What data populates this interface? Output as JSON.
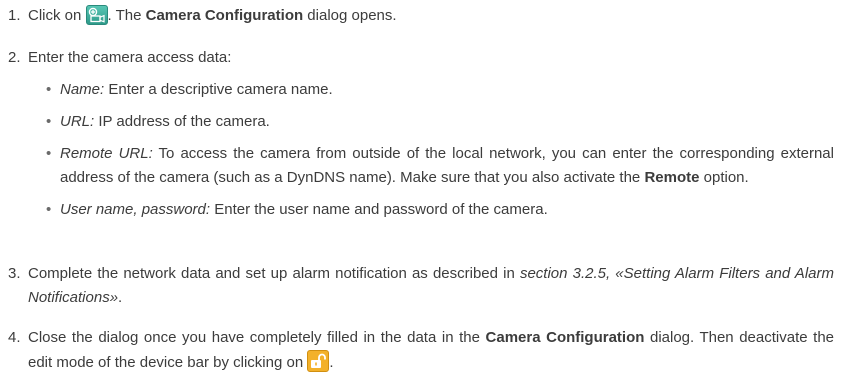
{
  "steps": [
    {
      "number": "1.",
      "pre": "Click on ",
      "mid": ". The ",
      "bold": "Camera Configuration",
      "post": " dialog opens."
    },
    {
      "number": "2.",
      "text": "Enter the camera access data:"
    },
    {
      "number": "3.",
      "pre": "Complete the network data and set up alarm notification as described in ",
      "italic": "section 3.2.5, «Setting Alarm Filters and Alarm Notifications»",
      "post": "."
    },
    {
      "number": "4.",
      "pre": "Close the dialog once you have completely filled in the data in the ",
      "bold": "Camera Configuration",
      "mid": " dialog. Then deactivate the edit mode of the device bar by clicking on ",
      "post": "."
    }
  ],
  "bullets": [
    {
      "term": "Name:",
      "text": " Enter a descriptive camera name."
    },
    {
      "term": "URL:",
      "text": " IP address of the camera."
    },
    {
      "term": "Remote URL:",
      "text": " To access the camera from outside of the local network, you can enter the corresponding external address of the camera (such as a DynDNS name). Make sure that you also activate the ",
      "bold": "Remote",
      "post": " option."
    },
    {
      "term": "User name, password:",
      "text": " Enter the user name and password of the camera."
    }
  ],
  "bullet_glyph": "•",
  "colors": {
    "text": "#3c3c3c",
    "camera_icon": "#3fb3a0",
    "lock_icon": "#f3b12a"
  },
  "icons": {
    "camera_add": "camera-add-icon",
    "lock": "unlock-icon"
  }
}
